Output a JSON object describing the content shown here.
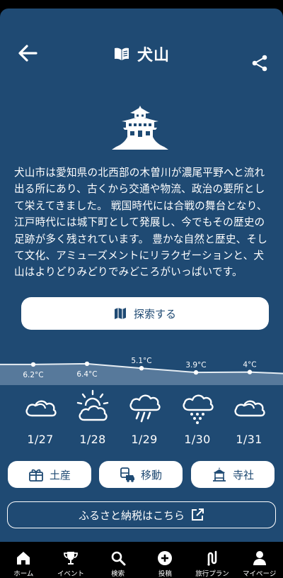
{
  "header": {
    "title": "犬山"
  },
  "description": "犬山市は愛知県の北西部の木曽川が濃尾平野へと流れ出る所にあり、古くから交通や物流、政治の要所として栄えてきました。 戦国時代には合戦の舞台となり、江戸時代には城下町として発展し、今でもその歴史の足跡が多く残されています。 豊かな自然と歴史、そして文化、アミューズメントにリラクゼーションと、犬山はよりどりみどりでみどころがいっぱいです。",
  "explore_button": {
    "label": "探索する"
  },
  "temperatures": [
    {
      "label": "6.2°C",
      "value": 6.2
    },
    {
      "label": "6.4°C",
      "value": 6.4
    },
    {
      "label": "5.1°C",
      "value": 5.1
    },
    {
      "label": "3.9°C",
      "value": 3.9
    },
    {
      "label": "4°C",
      "value": 4.0
    }
  ],
  "forecast": [
    {
      "date": "1/27",
      "icon": "cloudy-icon"
    },
    {
      "date": "1/28",
      "icon": "partly-sunny-icon"
    },
    {
      "date": "1/29",
      "icon": "rain-icon"
    },
    {
      "date": "1/30",
      "icon": "snow-icon"
    },
    {
      "date": "1/31",
      "icon": "cloudy-icon"
    }
  ],
  "categories": [
    {
      "label": "土産",
      "icon": "gift-icon"
    },
    {
      "label": "移動",
      "icon": "transport-icon"
    },
    {
      "label": "寺社",
      "icon": "shrine-icon"
    }
  ],
  "tax_button": {
    "label": "ふるさと納税はこちら"
  },
  "bottom_nav": [
    {
      "label": "ホーム",
      "icon": "home-icon"
    },
    {
      "label": "イベント",
      "icon": "trophy-icon"
    },
    {
      "label": "検索",
      "icon": "search-icon"
    },
    {
      "label": "投稿",
      "icon": "add-circle-icon"
    },
    {
      "label": "旅行プラン",
      "icon": "route-icon"
    },
    {
      "label": "マイページ",
      "icon": "person-icon"
    }
  ],
  "colors": {
    "background": "#1f4a73",
    "accent": "#ffffff",
    "nav_background": "#000000"
  }
}
